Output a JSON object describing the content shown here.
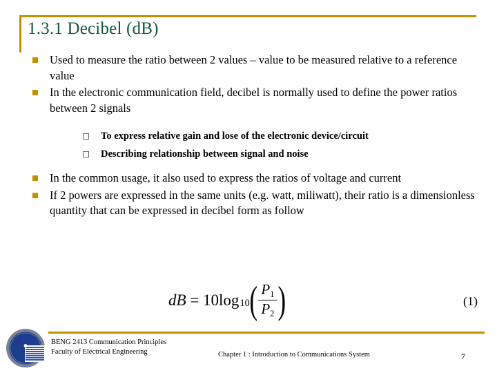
{
  "slide": {
    "title": "1.3.1 Decibel (dB)",
    "accent_gold": "#bf9000",
    "title_green": "#115740",
    "sub_bullet_green": "#4f6b52",
    "logo_navy": "#1f3d8f"
  },
  "bullets": [
    {
      "level": 1,
      "text": "Used to measure the ratio between 2 values – value to be measured relative to a reference value"
    },
    {
      "level": 1,
      "text": "In the electronic communication field, decibel is normally used to define the power ratios between 2 signals"
    }
  ],
  "sub_bullets": [
    {
      "level": 2,
      "text": "To express relative gain and lose of the electronic device/circuit"
    },
    {
      "level": 2,
      "text": "Describing relationship between signal and noise"
    }
  ],
  "bullets_after": [
    {
      "level": 1,
      "text": "In the common usage, it also used to express the ratios of voltage and current"
    },
    {
      "level": 1,
      "text": "If  2  powers are expressed in the same units (e.g. watt, miliwatt), their ratio is a dimensionless quantity that can be expressed in decibel form as follow"
    }
  ],
  "formula": {
    "lhs": "dB",
    "equals": "=",
    "coefficient": "10",
    "function": "log",
    "base": "10",
    "numerator": "P",
    "numerator_sub": "1",
    "denominator": "P",
    "denominator_sub": "2",
    "plain": "dB = 10 log10 ( P1 / P2 )",
    "number": "(1)"
  },
  "footer": {
    "course_line1": "BENG 2413 Communication Principles",
    "course_line2": "Faculty of Electrical Engineering",
    "chapter": "Chapter 1 : Introduction to Communications System",
    "page": "7",
    "logo_name": "university-seal-logo"
  }
}
